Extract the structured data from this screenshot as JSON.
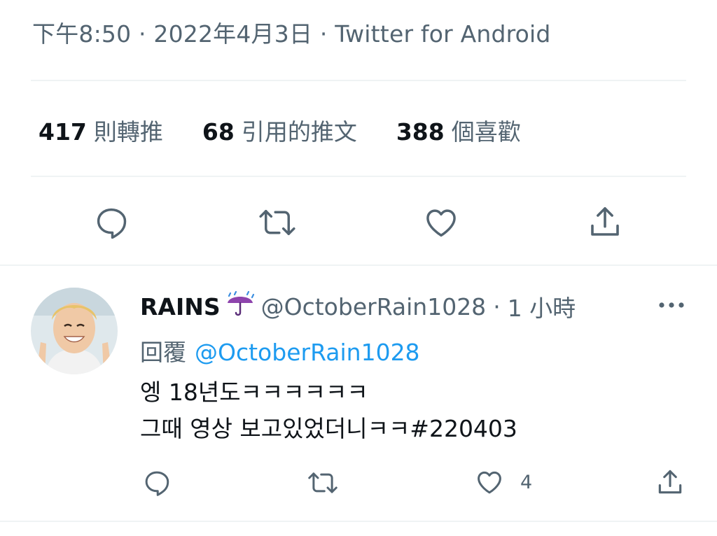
{
  "tweet": {
    "timestamp": "下午8:50 · 2022年4月3日 · Twitter for Android",
    "stats": {
      "retweets": {
        "count": "417",
        "label": "則轉推"
      },
      "quotes": {
        "count": "68",
        "label": "引用的推文"
      },
      "likes": {
        "count": "388",
        "label": "個喜歡"
      }
    },
    "actions": [
      "reply-icon",
      "retweet-icon",
      "like-icon",
      "share-icon"
    ]
  },
  "reply": {
    "display_name": "RAINS",
    "display_name_emoji": "umbrella-with-rain-icon",
    "handle": "@OctoberRain1028",
    "separator": "·",
    "time": "1 小時",
    "replying_label": "回覆",
    "replying_handle": "@OctoberRain1028",
    "lines": [
      "엥 18년도ㅋㅋㅋㅋㅋㅋ",
      "그때 영상 보고있었더니ㅋㅋ#220403"
    ],
    "like_count": "4",
    "more_icon": "more-options-icon"
  },
  "colors": {
    "text_primary": "#0f1419",
    "text_secondary": "#536471",
    "link": "#1d9bf0",
    "divider": "#eff3f4",
    "umbrella": "#8e44ad"
  }
}
